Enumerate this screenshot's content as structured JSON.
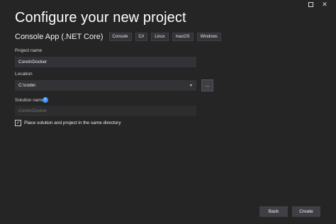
{
  "window": {
    "maximize_icon": "maximize-icon",
    "close_glyph": "✕"
  },
  "title": "Configure your new project",
  "template": {
    "name": "Console App (.NET Core)",
    "tags": [
      "Console",
      "C#",
      "Linux",
      "macOS",
      "Windows"
    ]
  },
  "project_name": {
    "label": "Project name",
    "value": "CoreInDocker"
  },
  "location": {
    "label": "Location",
    "value": "C:\\code\\",
    "browse_label": "..."
  },
  "solution_name": {
    "label": "Solution name",
    "placeholder": "CoreInDocker",
    "info_glyph": "i"
  },
  "same_directory": {
    "label": "Place solution and project in the same directory",
    "checked": true
  },
  "buttons": {
    "back": "Back",
    "create": "Create"
  }
}
